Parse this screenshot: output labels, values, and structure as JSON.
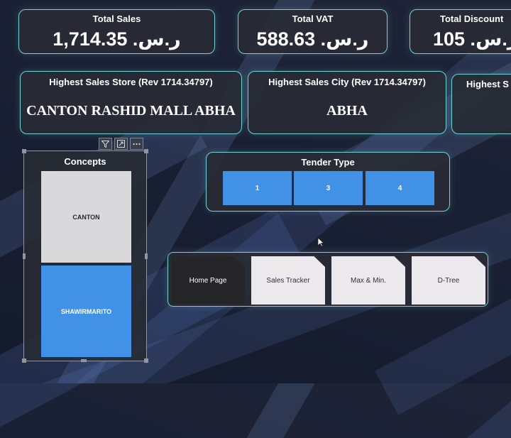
{
  "kpis_top": [
    {
      "title": "Total Sales",
      "value": "1,714.35 .ر.س"
    },
    {
      "title": "Total VAT",
      "value": "588.63 .ر.س"
    },
    {
      "title": "Total Discount",
      "value": "105 .ر.س"
    }
  ],
  "kpis_second": [
    {
      "title": "Highest Sales Store (Rev 1714.34797)",
      "value": "CANTON RASHID MALL ABHA"
    },
    {
      "title": "Highest Sales City (Rev 1714.34797)",
      "value": "ABHA"
    },
    {
      "title": "Highest S",
      "value": ""
    }
  ],
  "concepts": {
    "title": "Concepts",
    "tiles": [
      {
        "label": "CANTON",
        "color": "#d9d8db",
        "text_color": "#2a2a2a"
      },
      {
        "label": "SHAWIRMARITO",
        "color": "#4191e6",
        "text_color": "#ffffff"
      }
    ],
    "toolbar": [
      {
        "icon": "filter-icon",
        "glyph": "⏷"
      },
      {
        "icon": "focus-mode-icon",
        "glyph": "⤢"
      },
      {
        "icon": "more-options-icon",
        "glyph": "⋯"
      }
    ]
  },
  "tender_type": {
    "title": "Tender Type",
    "options": [
      "1",
      "3",
      "4"
    ],
    "color": "#4191e6"
  },
  "navigation": {
    "buttons": [
      {
        "label": "Home Page",
        "active": true
      },
      {
        "label": "Sales Tracker",
        "active": false
      },
      {
        "label": "Max & Min.",
        "active": false
      },
      {
        "label": "D-Tree",
        "active": false
      }
    ],
    "active_color": "#262629",
    "inactive_color": "#ece9ec"
  },
  "theme": {
    "accent_border": "#6fd3d6",
    "card_background": "#282b34"
  }
}
